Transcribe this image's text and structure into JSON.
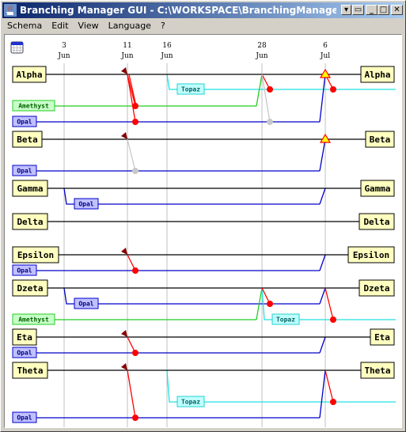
{
  "window": {
    "title": "Branching Manager GUI - C:\\WORKSPACE\\BranchingManager\\Branching",
    "buttons": [
      "menu",
      "restore-pane",
      "minimize",
      "maximize",
      "close"
    ]
  },
  "menubar": {
    "items": [
      "Schema",
      "Edit",
      "View",
      "Language",
      "?"
    ]
  },
  "calendar_icon": "calendar-icon",
  "timeline": {
    "dates": [
      {
        "day": "3",
        "month": "Jun"
      },
      {
        "day": "11",
        "month": "Jun"
      },
      {
        "day": "16",
        "month": "Jun"
      },
      {
        "day": "28",
        "month": "Jun"
      },
      {
        "day": "6",
        "month": "Jul"
      }
    ]
  },
  "colors": {
    "main_branch": "#000000",
    "opal": "#0000cc",
    "amethyst": "#22cc22",
    "topaz": "#22e0e0",
    "merge": "#ff0000",
    "merge_ghost": "#c8c8c8",
    "tag_arrow": "#800000",
    "release_triangle": "#ffff00",
    "main_label_bg": "#ffffc0",
    "opal_label_bg": "#c0c0ff",
    "amethyst_label_bg": "#c8ffc8",
    "topaz_label_bg": "#c0ffff"
  },
  "groups": [
    {
      "name": "Alpha",
      "sub": [
        {
          "name": "Amethyst",
          "type": "amethyst"
        },
        {
          "name": "Opal",
          "type": "opal"
        }
      ],
      "topaz": "Topaz"
    },
    {
      "name": "Beta",
      "sub": [
        {
          "name": "Opal",
          "type": "opal"
        }
      ]
    },
    {
      "name": "Gamma",
      "sub": [
        {
          "name": "Opal",
          "type": "opal"
        }
      ]
    },
    {
      "name": "Delta",
      "sub": []
    },
    {
      "name": "Epsilon",
      "sub": [
        {
          "name": "Opal",
          "type": "opal"
        }
      ]
    },
    {
      "name": "Dzeta",
      "sub": [
        {
          "name": "Opal",
          "type": "opal"
        },
        {
          "name": "Amethyst",
          "type": "amethyst"
        }
      ],
      "topaz": "Topaz"
    },
    {
      "name": "Eta",
      "sub": [
        {
          "name": "Opal",
          "type": "opal"
        }
      ]
    },
    {
      "name": "Theta",
      "sub": [
        {
          "name": "Opal",
          "type": "opal"
        }
      ],
      "topaz": "Topaz"
    }
  ],
  "labels": {
    "alpha": "Alpha",
    "beta": "Beta",
    "gamma": "Gamma",
    "delta": "Delta",
    "epsilon": "Epsilon",
    "dzeta": "Dzeta",
    "eta": "Eta",
    "theta": "Theta",
    "opal": "Opal",
    "amethyst": "Amethyst",
    "topaz": "Topaz"
  }
}
